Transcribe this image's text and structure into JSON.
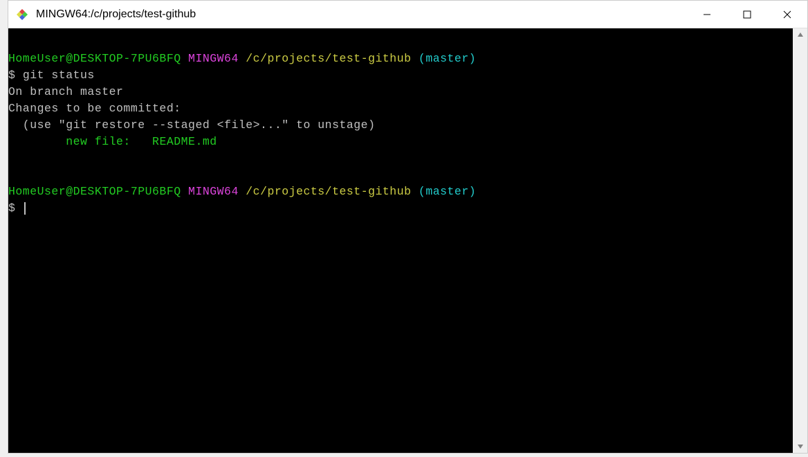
{
  "window": {
    "title": "MINGW64:/c/projects/test-github"
  },
  "terminal": {
    "prompt1": {
      "user": "HomeUser@DESKTOP-7PU6BFQ",
      "env": "MINGW64",
      "path": "/c/projects/test-github",
      "branch": "(master)"
    },
    "line_cmd1_prefix": "$ ",
    "line_cmd1": "git status",
    "line_out1": "On branch master",
    "line_out2": "Changes to be committed:",
    "line_out3": "  (use \"git restore --staged <file>...\" to unstage)",
    "line_out4_indent": "        ",
    "line_out4_text": "new file:   README.md",
    "prompt2": {
      "user": "HomeUser@DESKTOP-7PU6BFQ",
      "env": "MINGW64",
      "path": "/c/projects/test-github",
      "branch": "(master)"
    },
    "line_cmd2_prefix": "$ "
  }
}
